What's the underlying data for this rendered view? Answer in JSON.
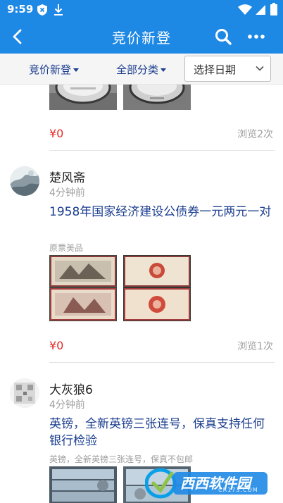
{
  "status_bar": {
    "time": "9:59",
    "left_icons": [
      "shield-x-icon",
      "download-icon"
    ],
    "right_icons": [
      "wifi-icon",
      "signal-icon",
      "battery-icon"
    ]
  },
  "app_bar": {
    "title": "竞价新登",
    "background": "#1e88e5",
    "icons": [
      "back-arrow-icon",
      "search-icon",
      "more-icon"
    ]
  },
  "filters": {
    "sort_label": "竞价新登",
    "category_label": "全部分类",
    "date_label": "选择日期"
  },
  "feed": {
    "partial_item": {
      "price": "¥0",
      "views": "浏览2次"
    },
    "items": [
      {
        "user": "楚风斋",
        "time": "4分钟前",
        "title": "1958年国家经济建设公债券一元两元一对",
        "desc": "原票美品",
        "price": "¥0",
        "views": "浏览1次"
      },
      {
        "user": "大灰狼6",
        "time": "4分钟前",
        "title": "英镑，全新英镑三张连号，保真支持任何银行检验",
        "desc": "英镑，全新英镑三张连号，保真不包邮"
      }
    ]
  },
  "watermark": {
    "text": "西西软件园",
    "sub": "CR173.COM"
  },
  "colors": {
    "brand_blue": "#1e88e5",
    "title_blue": "#1a3d8f",
    "price_red": "#e52a2a"
  }
}
